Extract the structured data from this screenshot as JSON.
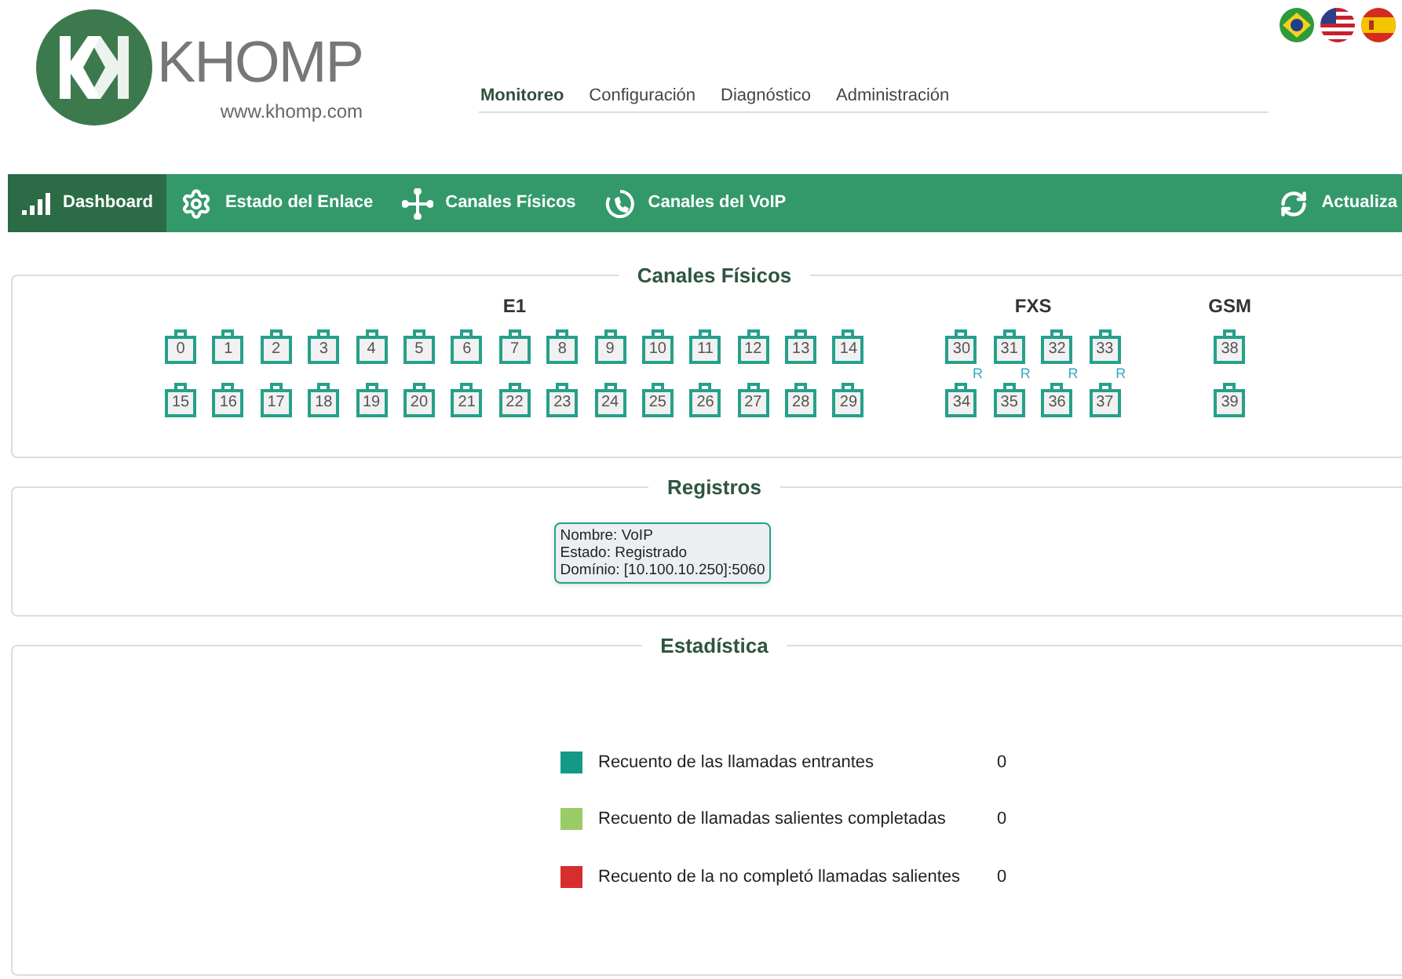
{
  "logo": {
    "name": "KHOMP",
    "url": "www.khomp.com"
  },
  "top_menu": [
    {
      "label": "Monitoreo",
      "selected": true
    },
    {
      "label": "Configuración",
      "selected": false
    },
    {
      "label": "Diagnóstico",
      "selected": false
    },
    {
      "label": "Administración",
      "selected": false
    }
  ],
  "languages": [
    {
      "kind": "brazil"
    },
    {
      "kind": "usa"
    },
    {
      "kind": "spain"
    }
  ],
  "nav": [
    {
      "label": "Dashboard",
      "kind": "signal",
      "selected": true
    },
    {
      "label": "Estado del Enlace",
      "kind": "gear",
      "selected": false
    },
    {
      "label": "Canales Físicos",
      "kind": "branch",
      "selected": false
    },
    {
      "label": "Canales del VoIP",
      "kind": "phone",
      "selected": false
    }
  ],
  "refresh": {
    "label": "Actualiza"
  },
  "physical_channels": {
    "title": "Canales Físicos",
    "groups": [
      {
        "title": "E1",
        "rows": [
          [
            {
              "number": "0"
            },
            {
              "number": "1"
            },
            {
              "number": "2"
            },
            {
              "number": "3"
            },
            {
              "number": "4"
            },
            {
              "number": "5"
            },
            {
              "number": "6"
            },
            {
              "number": "7"
            },
            {
              "number": "8"
            },
            {
              "number": "9"
            },
            {
              "number": "10"
            },
            {
              "number": "11"
            },
            {
              "number": "12"
            },
            {
              "number": "13"
            },
            {
              "number": "14"
            }
          ],
          [
            {
              "number": "15"
            },
            {
              "number": "16"
            },
            {
              "number": "17"
            },
            {
              "number": "18"
            },
            {
              "number": "19"
            },
            {
              "number": "20"
            },
            {
              "number": "21"
            },
            {
              "number": "22"
            },
            {
              "number": "23"
            },
            {
              "number": "24"
            },
            {
              "number": "25"
            },
            {
              "number": "26"
            },
            {
              "number": "27"
            },
            {
              "number": "28"
            },
            {
              "number": "29"
            }
          ]
        ]
      },
      {
        "title": "FXS",
        "rows": [
          [
            {
              "number": "30",
              "mark": "R"
            },
            {
              "number": "31",
              "mark": "R"
            },
            {
              "number": "32",
              "mark": "R"
            },
            {
              "number": "33",
              "mark": "R"
            }
          ],
          [
            {
              "number": "34"
            },
            {
              "number": "35"
            },
            {
              "number": "36"
            },
            {
              "number": "37"
            }
          ]
        ]
      },
      {
        "title": "GSM",
        "rows": [
          [
            {
              "number": "38"
            }
          ],
          [
            {
              "number": "39"
            }
          ]
        ]
      }
    ]
  },
  "registrations": {
    "title": "Registros",
    "entries": [
      {
        "lines": [
          "Nombre: VoIP",
          "Estado: Registrado",
          "Domínio: [10.100.10.250]:5060"
        ]
      }
    ]
  },
  "statistics": {
    "title": "Estadística",
    "items": [
      {
        "label": "Recuento de las llamadas entrantes",
        "value": "0",
        "color": "#139a87"
      },
      {
        "label": "Recuento de llamadas salientes completadas",
        "value": "0",
        "color": "#99cc66"
      },
      {
        "label": "Recuento de la no completó llamadas salientes",
        "value": "0",
        "color": "#d62e2e"
      }
    ]
  }
}
